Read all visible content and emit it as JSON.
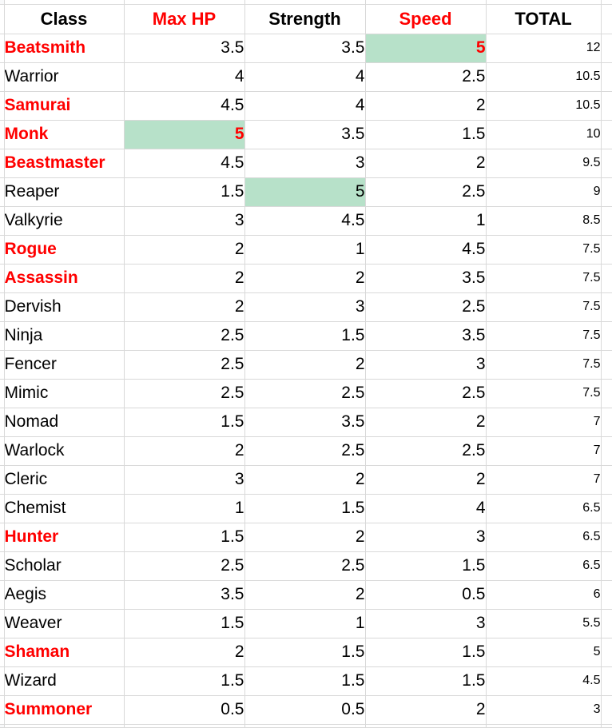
{
  "table": {
    "columns": [
      {
        "label": "Class",
        "name": "column-class",
        "red": false,
        "align": "left"
      },
      {
        "label": "Max HP",
        "name": "column-max-hp",
        "red": true,
        "align": "right"
      },
      {
        "label": "Strength",
        "name": "column-strength",
        "red": false,
        "align": "right"
      },
      {
        "label": "Speed",
        "name": "column-speed",
        "red": true,
        "align": "right"
      },
      {
        "label": "TOTAL",
        "name": "column-total",
        "red": false,
        "align": "right"
      }
    ],
    "colors": {
      "red_text": "#ff0000",
      "black_text": "#000000",
      "highlight_green": "#b7e1c9",
      "grid_line": "#d9d9d9",
      "gutter": "#f8f9fa",
      "background": "#ffffff"
    },
    "rows": [
      {
        "class": "Beatsmith",
        "class_red": true,
        "max_hp": "3.5",
        "strength": "3.5",
        "speed": "5",
        "total": "12",
        "max_hp_hl": false,
        "strength_hl": false,
        "speed_hl": true,
        "max_hp_red": false,
        "strength_red": false,
        "speed_red": true
      },
      {
        "class": "Warrior",
        "class_red": false,
        "max_hp": "4",
        "strength": "4",
        "speed": "2.5",
        "total": "10.5",
        "max_hp_hl": false,
        "strength_hl": false,
        "speed_hl": false,
        "max_hp_red": false,
        "strength_red": false,
        "speed_red": false
      },
      {
        "class": "Samurai",
        "class_red": true,
        "max_hp": "4.5",
        "strength": "4",
        "speed": "2",
        "total": "10.5",
        "max_hp_hl": false,
        "strength_hl": false,
        "speed_hl": false,
        "max_hp_red": false,
        "strength_red": false,
        "speed_red": false
      },
      {
        "class": "Monk",
        "class_red": true,
        "max_hp": "5",
        "strength": "3.5",
        "speed": "1.5",
        "total": "10",
        "max_hp_hl": true,
        "strength_hl": false,
        "speed_hl": false,
        "max_hp_red": true,
        "strength_red": false,
        "speed_red": false
      },
      {
        "class": "Beastmaster",
        "class_red": true,
        "max_hp": "4.5",
        "strength": "3",
        "speed": "2",
        "total": "9.5",
        "max_hp_hl": false,
        "strength_hl": false,
        "speed_hl": false,
        "max_hp_red": false,
        "strength_red": false,
        "speed_red": false
      },
      {
        "class": "Reaper",
        "class_red": false,
        "max_hp": "1.5",
        "strength": "5",
        "speed": "2.5",
        "total": "9",
        "max_hp_hl": false,
        "strength_hl": true,
        "speed_hl": false,
        "max_hp_red": false,
        "strength_red": false,
        "speed_red": false
      },
      {
        "class": "Valkyrie",
        "class_red": false,
        "max_hp": "3",
        "strength": "4.5",
        "speed": "1",
        "total": "8.5",
        "max_hp_hl": false,
        "strength_hl": false,
        "speed_hl": false,
        "max_hp_red": false,
        "strength_red": false,
        "speed_red": false
      },
      {
        "class": "Rogue",
        "class_red": true,
        "max_hp": "2",
        "strength": "1",
        "speed": "4.5",
        "total": "7.5",
        "max_hp_hl": false,
        "strength_hl": false,
        "speed_hl": false,
        "max_hp_red": false,
        "strength_red": false,
        "speed_red": false
      },
      {
        "class": "Assassin",
        "class_red": true,
        "max_hp": "2",
        "strength": "2",
        "speed": "3.5",
        "total": "7.5",
        "max_hp_hl": false,
        "strength_hl": false,
        "speed_hl": false,
        "max_hp_red": false,
        "strength_red": false,
        "speed_red": false
      },
      {
        "class": "Dervish",
        "class_red": false,
        "max_hp": "2",
        "strength": "3",
        "speed": "2.5",
        "total": "7.5",
        "max_hp_hl": false,
        "strength_hl": false,
        "speed_hl": false,
        "max_hp_red": false,
        "strength_red": false,
        "speed_red": false
      },
      {
        "class": "Ninja",
        "class_red": false,
        "max_hp": "2.5",
        "strength": "1.5",
        "speed": "3.5",
        "total": "7.5",
        "max_hp_hl": false,
        "strength_hl": false,
        "speed_hl": false,
        "max_hp_red": false,
        "strength_red": false,
        "speed_red": false
      },
      {
        "class": "Fencer",
        "class_red": false,
        "max_hp": "2.5",
        "strength": "2",
        "speed": "3",
        "total": "7.5",
        "max_hp_hl": false,
        "strength_hl": false,
        "speed_hl": false,
        "max_hp_red": false,
        "strength_red": false,
        "speed_red": false
      },
      {
        "class": "Mimic",
        "class_red": false,
        "max_hp": "2.5",
        "strength": "2.5",
        "speed": "2.5",
        "total": "7.5",
        "max_hp_hl": false,
        "strength_hl": false,
        "speed_hl": false,
        "max_hp_red": false,
        "strength_red": false,
        "speed_red": false
      },
      {
        "class": "Nomad",
        "class_red": false,
        "max_hp": "1.5",
        "strength": "3.5",
        "speed": "2",
        "total": "7",
        "max_hp_hl": false,
        "strength_hl": false,
        "speed_hl": false,
        "max_hp_red": false,
        "strength_red": false,
        "speed_red": false
      },
      {
        "class": "Warlock",
        "class_red": false,
        "max_hp": "2",
        "strength": "2.5",
        "speed": "2.5",
        "total": "7",
        "max_hp_hl": false,
        "strength_hl": false,
        "speed_hl": false,
        "max_hp_red": false,
        "strength_red": false,
        "speed_red": false
      },
      {
        "class": "Cleric",
        "class_red": false,
        "max_hp": "3",
        "strength": "2",
        "speed": "2",
        "total": "7",
        "max_hp_hl": false,
        "strength_hl": false,
        "speed_hl": false,
        "max_hp_red": false,
        "strength_red": false,
        "speed_red": false
      },
      {
        "class": "Chemist",
        "class_red": false,
        "max_hp": "1",
        "strength": "1.5",
        "speed": "4",
        "total": "6.5",
        "max_hp_hl": false,
        "strength_hl": false,
        "speed_hl": false,
        "max_hp_red": false,
        "strength_red": false,
        "speed_red": false
      },
      {
        "class": "Hunter",
        "class_red": true,
        "max_hp": "1.5",
        "strength": "2",
        "speed": "3",
        "total": "6.5",
        "max_hp_hl": false,
        "strength_hl": false,
        "speed_hl": false,
        "max_hp_red": false,
        "strength_red": false,
        "speed_red": false
      },
      {
        "class": "Scholar",
        "class_red": false,
        "max_hp": "2.5",
        "strength": "2.5",
        "speed": "1.5",
        "total": "6.5",
        "max_hp_hl": false,
        "strength_hl": false,
        "speed_hl": false,
        "max_hp_red": false,
        "strength_red": false,
        "speed_red": false
      },
      {
        "class": "Aegis",
        "class_red": false,
        "max_hp": "3.5",
        "strength": "2",
        "speed": "0.5",
        "total": "6",
        "max_hp_hl": false,
        "strength_hl": false,
        "speed_hl": false,
        "max_hp_red": false,
        "strength_red": false,
        "speed_red": false
      },
      {
        "class": "Weaver",
        "class_red": false,
        "max_hp": "1.5",
        "strength": "1",
        "speed": "3",
        "total": "5.5",
        "max_hp_hl": false,
        "strength_hl": false,
        "speed_hl": false,
        "max_hp_red": false,
        "strength_red": false,
        "speed_red": false
      },
      {
        "class": "Shaman",
        "class_red": true,
        "max_hp": "2",
        "strength": "1.5",
        "speed": "1.5",
        "total": "5",
        "max_hp_hl": false,
        "strength_hl": false,
        "speed_hl": false,
        "max_hp_red": false,
        "strength_red": false,
        "speed_red": false
      },
      {
        "class": "Wizard",
        "class_red": false,
        "max_hp": "1.5",
        "strength": "1.5",
        "speed": "1.5",
        "total": "4.5",
        "max_hp_hl": false,
        "strength_hl": false,
        "speed_hl": false,
        "max_hp_red": false,
        "strength_red": false,
        "speed_red": false
      },
      {
        "class": "Summoner",
        "class_red": true,
        "max_hp": "0.5",
        "strength": "0.5",
        "speed": "2",
        "total": "3",
        "max_hp_hl": false,
        "strength_hl": false,
        "speed_hl": false,
        "max_hp_red": false,
        "strength_red": false,
        "speed_red": false
      }
    ]
  }
}
